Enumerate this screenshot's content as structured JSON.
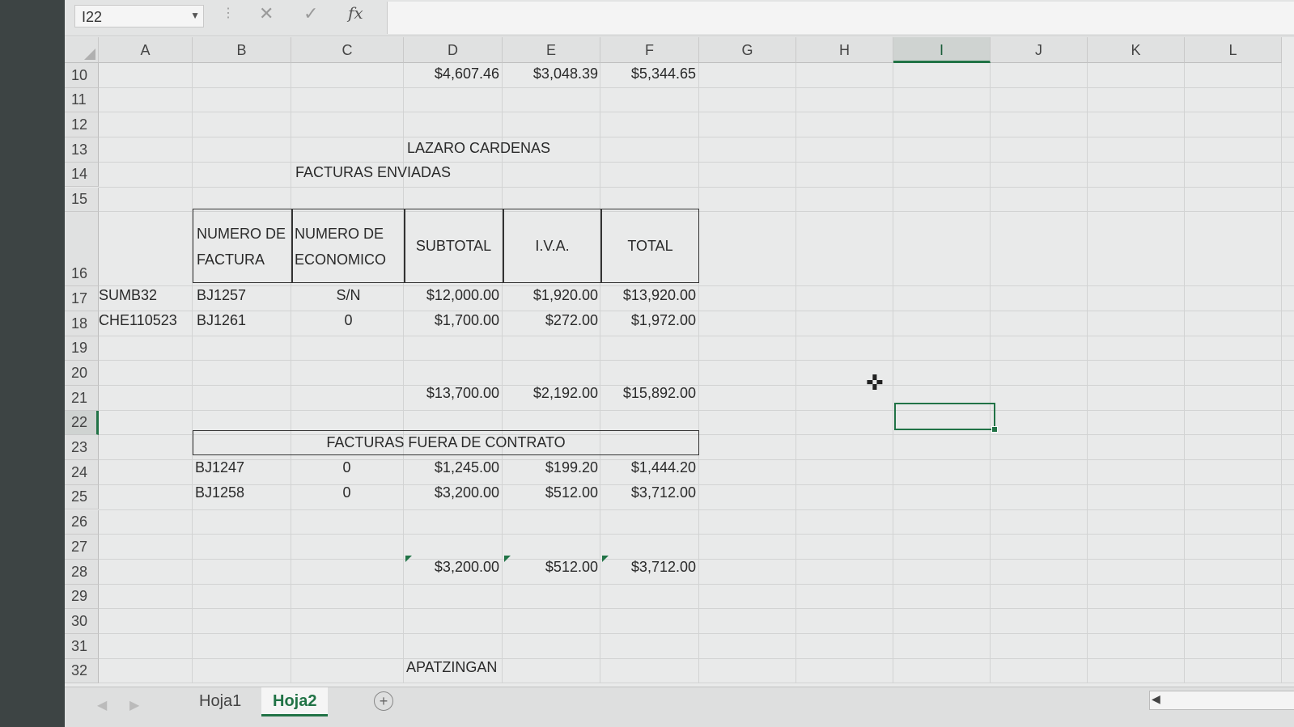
{
  "formula_bar": {
    "name_box": "I22",
    "fx_label": "fx",
    "cancel_icon": "✕",
    "enter_icon": "✓"
  },
  "columns": [
    "A",
    "B",
    "C",
    "D",
    "E",
    "F",
    "G",
    "H",
    "I",
    "J",
    "K",
    "L"
  ],
  "selected_column": "I",
  "rows": [
    "10",
    "11",
    "12",
    "13",
    "14",
    "15",
    "16",
    "17",
    "18",
    "19",
    "20",
    "21",
    "22",
    "23",
    "24",
    "25",
    "26",
    "27",
    "28",
    "29",
    "30",
    "31",
    "32"
  ],
  "selected_row": "22",
  "selected_cell": "I22",
  "cells": {
    "D10": "$4,607.46",
    "E10": "$3,048.39",
    "F10": "$5,344.65",
    "D13": "LAZARO CARDENAS",
    "C14": "FACTURAS ENVIADAS",
    "B16a": "NUMERO DE",
    "B16b": "FACTURA",
    "C16a": "NUMERO DE",
    "C16b": "ECONOMICO",
    "D16": "SUBTOTAL",
    "E16": "I.V.A.",
    "F16": "TOTAL",
    "A17": "SUMB32",
    "B17": "BJ1257",
    "C17": "S/N",
    "D17": "$12,000.00",
    "E17": "$1,920.00",
    "F17": "$13,920.00",
    "A18": "CHE110523",
    "B18": "BJ1261",
    "C18": "0",
    "D18": "$1,700.00",
    "E18": "$272.00",
    "F18": "$1,972.00",
    "D21": "$13,700.00",
    "E21": "$2,192.00",
    "F21": "$15,892.00",
    "B23": "FACTURAS FUERA DE CONTRATO",
    "B24": "BJ1247",
    "C24": "0",
    "D24": "$1,245.00",
    "E24": "$199.20",
    "F24": "$1,444.20",
    "B25": "BJ1258",
    "C25": "0",
    "D25": "$3,200.00",
    "E25": "$512.00",
    "F25": "$3,712.00",
    "D28": "$3,200.00",
    "E28": "$512.00",
    "F28": "$3,712.00",
    "D32": "APATZINGAN"
  },
  "sheet_tabs": [
    {
      "label": "Hoja1",
      "active": false
    },
    {
      "label": "Hoja2",
      "active": true
    }
  ],
  "add_sheet_label": "+",
  "colors": {
    "accent": "#217346"
  }
}
